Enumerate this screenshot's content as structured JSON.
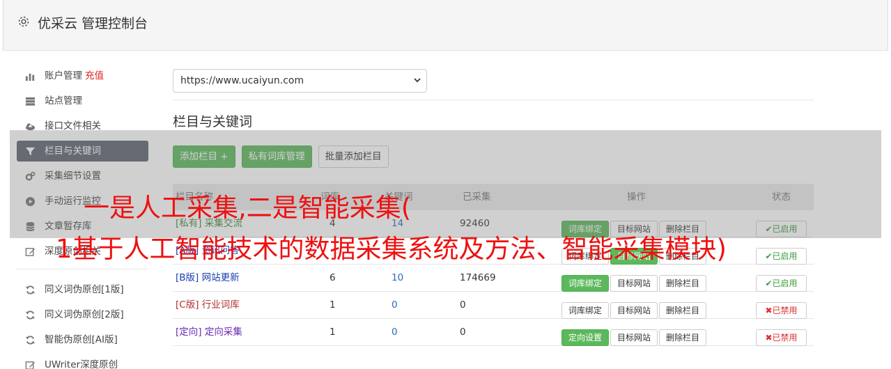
{
  "app": {
    "title": "优采云 管理控制台",
    "icon": "gear-icon"
  },
  "sidebar": {
    "items": [
      {
        "label": "账户管理",
        "extra": "充值",
        "icon": "bar-chart-icon"
      },
      {
        "label": "站点管理",
        "icon": "server-icon"
      },
      {
        "label": "接口文件相关",
        "icon": "cloud-upload-icon"
      },
      {
        "label": "栏目与关键词",
        "icon": "filter-icon",
        "active": true
      },
      {
        "label": "采集细节设置",
        "icon": "cogs-icon"
      },
      {
        "label": "手动运行监控",
        "icon": "play-circle-icon"
      },
      {
        "label": "文章暂存库",
        "icon": "database-icon"
      },
      {
        "label": "深度原创相关",
        "icon": "edit-icon"
      }
    ],
    "items2": [
      {
        "label": "同义词伪原创[1版]",
        "icon": "refresh-icon"
      },
      {
        "label": "同义词伪原创[2版]",
        "icon": "refresh-icon"
      },
      {
        "label": "智能伪原创[AI版]",
        "icon": "refresh-icon"
      },
      {
        "label": "UWriter深度原创",
        "icon": "edit-icon"
      }
    ]
  },
  "site_select": {
    "value": "https://www.ucaiyun.com"
  },
  "section": {
    "title": "栏目与关键词"
  },
  "buttons": {
    "add": "添加栏目 +",
    "private": "私有词库管理",
    "batch": "批量添加栏目"
  },
  "table": {
    "headers": [
      "栏目名称",
      "词库",
      "关键词",
      "已采集",
      "操作",
      "状态"
    ],
    "rows": [
      {
        "tag": "[私有]",
        "name": "采集交流",
        "n1": "4",
        "n2": "14",
        "n3": "92460",
        "op1": "词库绑定",
        "op2": "目标网站",
        "op3": "删除栏目",
        "status": "✔已启用"
      },
      {
        "tag": "[A版]",
        "name": "资讯问答",
        "n1": "",
        "n2": "",
        "n3": "",
        "op1": "词库绑定",
        "op2": "目标网站",
        "op3": "删除栏目",
        "status": "✔已启用"
      },
      {
        "tag": "[B版]",
        "name": "网站更新",
        "n1": "6",
        "n2": "10",
        "n3": "174669",
        "op1": "词库绑定",
        "op2": "目标网站",
        "op3": "删除栏目",
        "status": "✔已启用"
      },
      {
        "tag": "[C版]",
        "name": "行业词库",
        "n1": "1",
        "n2": "0",
        "n3": "0",
        "op1": "词库绑定",
        "op2": "目标网站",
        "op3": "删除栏目",
        "status": "✖已禁用"
      },
      {
        "tag": "[定向]",
        "name": "定向采集",
        "n1": "1",
        "n2": "0",
        "n3": "0",
        "op1": "定向设置",
        "op2": "目标网站",
        "op3": "删除栏目",
        "status": "✖已禁用"
      }
    ]
  },
  "overlay": {
    "line1": "一是人工采集,二是智能采集(",
    "line2": "1基于人工智能技术的数据采集系统及方法、智能采集模块)"
  }
}
